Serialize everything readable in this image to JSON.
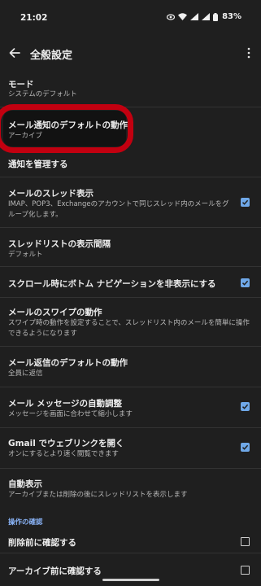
{
  "status": {
    "time": "21:02",
    "battery": "83%"
  },
  "app_bar": {
    "title": "全般設定"
  },
  "settings": {
    "mode": {
      "title": "モード",
      "sub": "システムのデフォルト"
    },
    "notify_default": {
      "title": "メール通知のデフォルトの動作",
      "sub": "アーカイブ"
    },
    "manage_notify": {
      "title": "通知を管理する"
    },
    "thread_view": {
      "title": "メールのスレッド表示",
      "sub": "IMAP、POP3、Exchangeのアカウントで同じスレッド内のメールをグループ化します。",
      "checked": true
    },
    "thread_density": {
      "title": "スレッドリストの表示間隔",
      "sub": "デフォルト"
    },
    "hide_bottom_nav": {
      "title": "スクロール時にボトム ナビゲーションを非表示にする",
      "checked": true
    },
    "swipe_actions": {
      "title": "メールのスワイプの動作",
      "sub": "スワイプ時の動作を設定することで、スレッドリスト内のメールを簡単に操作できるようになります"
    },
    "reply_default": {
      "title": "メール返信のデフォルトの動作",
      "sub": "全員に返信"
    },
    "auto_fit": {
      "title": "メール メッセージの自動調整",
      "sub": "メッセージを画面に合わせて縮小します",
      "checked": true
    },
    "web_links": {
      "title": "Gmail でウェブリンクを開く",
      "sub": "オンにするとより速く閲覧できます",
      "checked": true
    },
    "auto_advance": {
      "title": "自動表示",
      "sub": "アーカイブまたは削除の後にスレッドリストを表示します"
    },
    "confirm_section": {
      "label": "操作の確認"
    },
    "confirm_delete": {
      "title": "削除前に確認する",
      "checked": false
    },
    "confirm_archive": {
      "title": "アーカイブ前に確認する",
      "checked": false
    }
  },
  "colors": {
    "background": "#1f1f1f",
    "accent": "#8ab4f8",
    "checkbox": "#6fa8e8",
    "highlight": "#c20010"
  },
  "icons": {
    "back": "arrow-back-icon",
    "overflow": "more-vert-icon",
    "wifi": "wifi-icon",
    "signal": "signal-icon",
    "battery": "battery-icon",
    "eye": "eye-icon"
  }
}
